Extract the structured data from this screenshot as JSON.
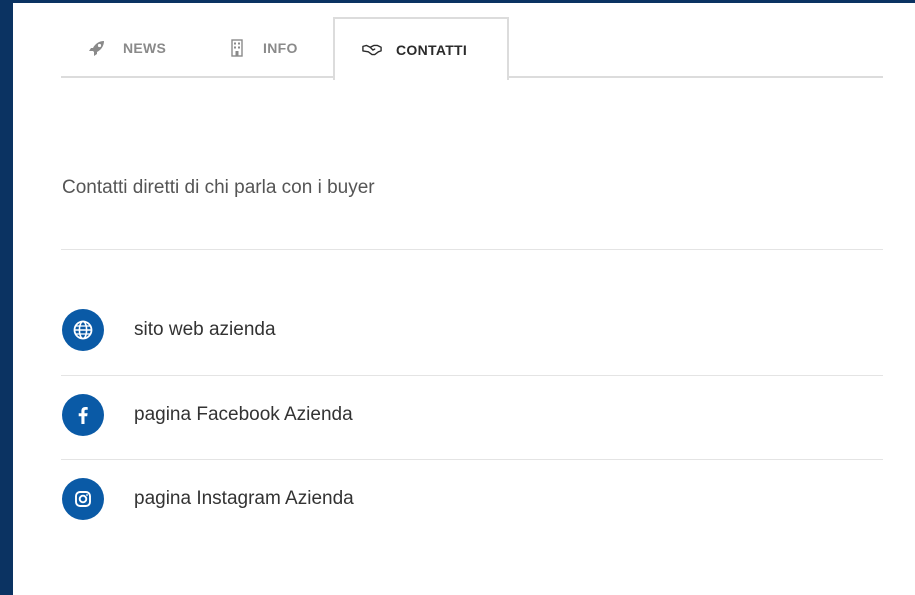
{
  "tabs": [
    {
      "label": "NEWS",
      "icon": "rocket-icon",
      "active": false
    },
    {
      "label": "INFO",
      "icon": "building-icon",
      "active": false
    },
    {
      "label": "CONTATTI",
      "icon": "handshake-icon",
      "active": true
    }
  ],
  "description": "Contatti diretti di chi parla con i buyer",
  "contacts": [
    {
      "label": "sito web azienda",
      "icon": "globe-icon"
    },
    {
      "label": "pagina Facebook Azienda",
      "icon": "facebook-icon"
    },
    {
      "label": "pagina Instagram Azienda",
      "icon": "instagram-icon"
    }
  ],
  "colors": {
    "background": "#0b3362",
    "accent": "#0a5aa6",
    "active_tab_text": "#2b2b2b",
    "inactive_tab_text": "#8a8a8a"
  }
}
